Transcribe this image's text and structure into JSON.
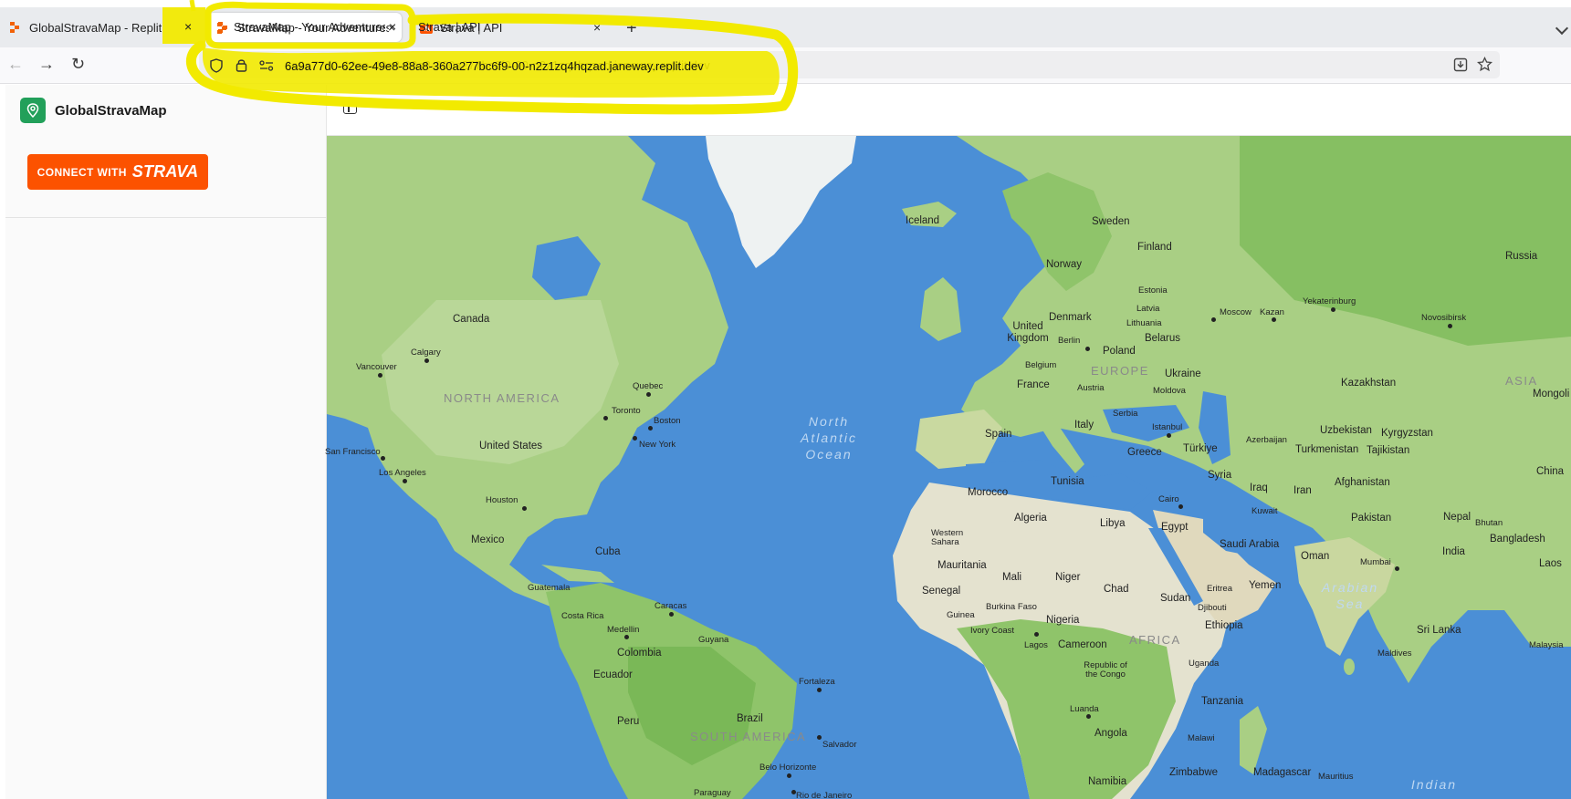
{
  "browser": {
    "tabs": [
      {
        "title": "GlobalStravaMap - Replit",
        "active": false,
        "favicon": "replit-icon"
      },
      {
        "title": "StravaMap - Your Adventures, M",
        "active": true,
        "favicon": "replit-icon"
      },
      {
        "title": "Strava | API",
        "active": false,
        "favicon": "strava-icon"
      }
    ],
    "new_tab_symbol": "+",
    "close_symbol": "×",
    "url": "6a9a77d0-62ee-49e8-88a8-360a277bc6f9-00-n2z1zq4hqzad.janeway.replit.dev"
  },
  "sidebar": {
    "app_name": "GlobalStravaMap",
    "connect_prefix": "CONNECT WITH",
    "connect_brand": "STRAVA"
  },
  "map": {
    "oceans": [
      {
        "id": "north-atlantic",
        "lines": [
          "North",
          "Atlantic",
          "Ocean"
        ]
      },
      {
        "id": "arabian-sea",
        "lines": [
          "Arabian",
          "Sea"
        ]
      },
      {
        "id": "indian",
        "lines": [
          "Indian"
        ]
      }
    ],
    "regions": [
      "NORTH AMERICA",
      "SOUTH AMERICA",
      "EUROPE",
      "AFRICA",
      "ASIA"
    ],
    "countries": [
      "Canada",
      "United States",
      "Mexico",
      "Cuba",
      "Guatemala",
      "Costa Rica",
      "Colombia",
      "Ecuador",
      "Peru",
      "Brazil",
      "Guyana",
      "Paraguay",
      "Iceland",
      "Sweden",
      "Norway",
      "Finland",
      "Denmark",
      "Estonia",
      "Latvia",
      "Lithuania",
      "United Kingdom",
      "Poland",
      "Belarus",
      "Belgium",
      "France",
      "Austria",
      "Ukraine",
      "Moldova",
      "Spain",
      "Italy",
      "Serbia",
      "Greece",
      "Türkiye",
      "Russia",
      "Kazakhstan",
      "Mongoli",
      "Uzbekistan",
      "Kyrgyzstan",
      "Turkmenistan",
      "Tajikistan",
      "Azerbaijan",
      "Syria",
      "Iraq",
      "Iran",
      "Afghanistan",
      "Pakistan",
      "Nepal",
      "Bhutan",
      "Bangladesh",
      "India",
      "Sri Lanka",
      "Maldives",
      "China",
      "Laos",
      "Malaysia",
      "Kuwait",
      "Oman",
      "Saudi Arabia",
      "Yemen",
      "Eritrea",
      "Djibouti",
      "Ethiopia",
      "Egypt",
      "Libya",
      "Chad",
      "Sudan",
      "Tunisia",
      "Algeria",
      "Morocco",
      "Western Sahara",
      "Mauritania",
      "Mali",
      "Niger",
      "Nigeria",
      "Senegal",
      "Burkina Faso",
      "Guinea",
      "Ivory Coast",
      "Cameroon",
      "Republic of the Congo",
      "Uganda",
      "Tanzania",
      "Malawi",
      "Angola",
      "Zimbabwe",
      "Namibia",
      "Madagascar",
      "Mauritius"
    ],
    "cities": [
      "Calgary",
      "Vancouver",
      "San Francisco",
      "Los Angeles",
      "Houston",
      "Toronto",
      "Quebec",
      "Boston",
      "New York",
      "Caracas",
      "Medellin",
      "Fortaleza",
      "Salvador",
      "Belo Horizonte",
      "Rio de Janeiro",
      "Moscow",
      "Kazan",
      "Yekaterinburg",
      "Novosibirsk",
      "Berlin",
      "Istanbul",
      "Cairo",
      "Mumbai",
      "Lagos",
      "Luanda"
    ]
  },
  "colors": {
    "tabbar": "#e9ebee",
    "highlight": "#f2ea00",
    "strava_orange": "#fc5200",
    "brand_green": "#22a05a",
    "ocean": "#4b8fd6",
    "land": "#a9cf84"
  }
}
